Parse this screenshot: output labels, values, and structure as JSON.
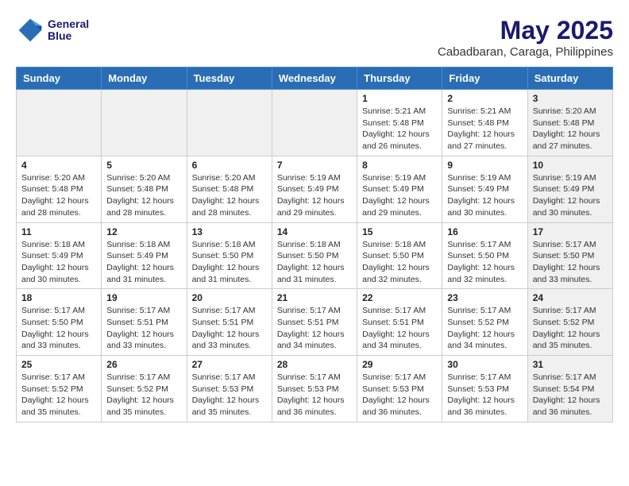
{
  "header": {
    "logo_line1": "General",
    "logo_line2": "Blue",
    "month_year": "May 2025",
    "location": "Cabadbaran, Caraga, Philippines"
  },
  "days_of_week": [
    "Sunday",
    "Monday",
    "Tuesday",
    "Wednesday",
    "Thursday",
    "Friday",
    "Saturday"
  ],
  "weeks": [
    [
      {
        "day": "",
        "info": "",
        "shaded": true
      },
      {
        "day": "",
        "info": "",
        "shaded": true
      },
      {
        "day": "",
        "info": "",
        "shaded": true
      },
      {
        "day": "",
        "info": "",
        "shaded": true
      },
      {
        "day": "1",
        "info": "Sunrise: 5:21 AM\nSunset: 5:48 PM\nDaylight: 12 hours and 26 minutes.",
        "shaded": false
      },
      {
        "day": "2",
        "info": "Sunrise: 5:21 AM\nSunset: 5:48 PM\nDaylight: 12 hours and 27 minutes.",
        "shaded": false
      },
      {
        "day": "3",
        "info": "Sunrise: 5:20 AM\nSunset: 5:48 PM\nDaylight: 12 hours and 27 minutes.",
        "shaded": true
      }
    ],
    [
      {
        "day": "4",
        "info": "Sunrise: 5:20 AM\nSunset: 5:48 PM\nDaylight: 12 hours and 28 minutes.",
        "shaded": false
      },
      {
        "day": "5",
        "info": "Sunrise: 5:20 AM\nSunset: 5:48 PM\nDaylight: 12 hours and 28 minutes.",
        "shaded": false
      },
      {
        "day": "6",
        "info": "Sunrise: 5:20 AM\nSunset: 5:48 PM\nDaylight: 12 hours and 28 minutes.",
        "shaded": false
      },
      {
        "day": "7",
        "info": "Sunrise: 5:19 AM\nSunset: 5:49 PM\nDaylight: 12 hours and 29 minutes.",
        "shaded": false
      },
      {
        "day": "8",
        "info": "Sunrise: 5:19 AM\nSunset: 5:49 PM\nDaylight: 12 hours and 29 minutes.",
        "shaded": false
      },
      {
        "day": "9",
        "info": "Sunrise: 5:19 AM\nSunset: 5:49 PM\nDaylight: 12 hours and 30 minutes.",
        "shaded": false
      },
      {
        "day": "10",
        "info": "Sunrise: 5:19 AM\nSunset: 5:49 PM\nDaylight: 12 hours and 30 minutes.",
        "shaded": true
      }
    ],
    [
      {
        "day": "11",
        "info": "Sunrise: 5:18 AM\nSunset: 5:49 PM\nDaylight: 12 hours and 30 minutes.",
        "shaded": false
      },
      {
        "day": "12",
        "info": "Sunrise: 5:18 AM\nSunset: 5:49 PM\nDaylight: 12 hours and 31 minutes.",
        "shaded": false
      },
      {
        "day": "13",
        "info": "Sunrise: 5:18 AM\nSunset: 5:50 PM\nDaylight: 12 hours and 31 minutes.",
        "shaded": false
      },
      {
        "day": "14",
        "info": "Sunrise: 5:18 AM\nSunset: 5:50 PM\nDaylight: 12 hours and 31 minutes.",
        "shaded": false
      },
      {
        "day": "15",
        "info": "Sunrise: 5:18 AM\nSunset: 5:50 PM\nDaylight: 12 hours and 32 minutes.",
        "shaded": false
      },
      {
        "day": "16",
        "info": "Sunrise: 5:17 AM\nSunset: 5:50 PM\nDaylight: 12 hours and 32 minutes.",
        "shaded": false
      },
      {
        "day": "17",
        "info": "Sunrise: 5:17 AM\nSunset: 5:50 PM\nDaylight: 12 hours and 33 minutes.",
        "shaded": true
      }
    ],
    [
      {
        "day": "18",
        "info": "Sunrise: 5:17 AM\nSunset: 5:50 PM\nDaylight: 12 hours and 33 minutes.",
        "shaded": false
      },
      {
        "day": "19",
        "info": "Sunrise: 5:17 AM\nSunset: 5:51 PM\nDaylight: 12 hours and 33 minutes.",
        "shaded": false
      },
      {
        "day": "20",
        "info": "Sunrise: 5:17 AM\nSunset: 5:51 PM\nDaylight: 12 hours and 33 minutes.",
        "shaded": false
      },
      {
        "day": "21",
        "info": "Sunrise: 5:17 AM\nSunset: 5:51 PM\nDaylight: 12 hours and 34 minutes.",
        "shaded": false
      },
      {
        "day": "22",
        "info": "Sunrise: 5:17 AM\nSunset: 5:51 PM\nDaylight: 12 hours and 34 minutes.",
        "shaded": false
      },
      {
        "day": "23",
        "info": "Sunrise: 5:17 AM\nSunset: 5:52 PM\nDaylight: 12 hours and 34 minutes.",
        "shaded": false
      },
      {
        "day": "24",
        "info": "Sunrise: 5:17 AM\nSunset: 5:52 PM\nDaylight: 12 hours and 35 minutes.",
        "shaded": true
      }
    ],
    [
      {
        "day": "25",
        "info": "Sunrise: 5:17 AM\nSunset: 5:52 PM\nDaylight: 12 hours and 35 minutes.",
        "shaded": false
      },
      {
        "day": "26",
        "info": "Sunrise: 5:17 AM\nSunset: 5:52 PM\nDaylight: 12 hours and 35 minutes.",
        "shaded": false
      },
      {
        "day": "27",
        "info": "Sunrise: 5:17 AM\nSunset: 5:53 PM\nDaylight: 12 hours and 35 minutes.",
        "shaded": false
      },
      {
        "day": "28",
        "info": "Sunrise: 5:17 AM\nSunset: 5:53 PM\nDaylight: 12 hours and 36 minutes.",
        "shaded": false
      },
      {
        "day": "29",
        "info": "Sunrise: 5:17 AM\nSunset: 5:53 PM\nDaylight: 12 hours and 36 minutes.",
        "shaded": false
      },
      {
        "day": "30",
        "info": "Sunrise: 5:17 AM\nSunset: 5:53 PM\nDaylight: 12 hours and 36 minutes.",
        "shaded": false
      },
      {
        "day": "31",
        "info": "Sunrise: 5:17 AM\nSunset: 5:54 PM\nDaylight: 12 hours and 36 minutes.",
        "shaded": true
      }
    ]
  ]
}
